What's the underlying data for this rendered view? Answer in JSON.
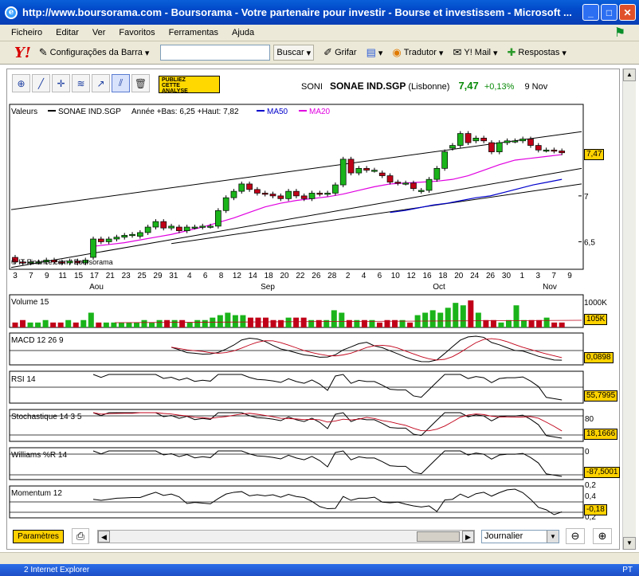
{
  "window": {
    "title": "http://www.boursorama.com - Boursorama - Votre partenaire pour investir - Bourse et investissem - Microsoft ...",
    "minimize": "_",
    "maximize": "□",
    "close": "✕"
  },
  "menu": [
    "Ficheiro",
    "Editar",
    "Ver",
    "Favoritos",
    "Ferramentas",
    "Ajuda"
  ],
  "toolbar": {
    "brand": "Y!",
    "config": "Configurações da Barra",
    "search_value": "",
    "search_button": "Buscar",
    "grifar": "Grifar",
    "tradutor": "Tradutor",
    "ymail": "Y! Mail",
    "respostas": "Respostas"
  },
  "publiez": {
    "line1": "PUBLIEZ",
    "line2": "CETTE",
    "line3": "ANALYSE"
  },
  "quote": {
    "symbol": "SONI",
    "name": "SONAE IND.SGP",
    "market": "(Lisbonne)",
    "price": "7,47",
    "change": "+0,13%",
    "date": "9 Nov"
  },
  "legend": {
    "valeurs": "Valeurs",
    "instrument": "SONAE IND.SGP",
    "range": "Année +Bas: 6,25 +Haut: 7,82",
    "ma50": "MA50",
    "ma20": "MA20",
    "ma50_color": "#0000cc",
    "ma20_color": "#e000e0"
  },
  "chart_data": {
    "type": "candlestick",
    "price_ticks": [
      "7",
      "6,5"
    ],
    "last_value_label": "7,47",
    "x_ticks": [
      "3",
      "7",
      "9",
      "11",
      "15",
      "17",
      "21",
      "23",
      "25",
      "29",
      "31",
      "4",
      "6",
      "8",
      "12",
      "14",
      "18",
      "20",
      "22",
      "26",
      "28",
      "2",
      "4",
      "6",
      "10",
      "12",
      "16",
      "18",
      "20",
      "24",
      "26",
      "30",
      "1",
      "3",
      "7",
      "9"
    ],
    "months": [
      "Aou",
      "Sep",
      "Oct",
      "Nov"
    ],
    "candles": [
      {
        "o": 6.33,
        "c": 6.28
      },
      {
        "o": 6.28,
        "c": 6.27
      },
      {
        "o": 6.27,
        "c": 6.28
      },
      {
        "o": 6.28,
        "c": 6.28
      },
      {
        "o": 6.28,
        "c": 6.3
      },
      {
        "o": 6.3,
        "c": 6.28
      },
      {
        "o": 6.28,
        "c": 6.27
      },
      {
        "o": 6.27,
        "c": 6.29
      },
      {
        "o": 6.29,
        "c": 6.27
      },
      {
        "o": 6.27,
        "c": 6.3
      },
      {
        "o": 6.33,
        "c": 6.53
      },
      {
        "o": 6.53,
        "c": 6.5
      },
      {
        "o": 6.5,
        "c": 6.53
      },
      {
        "o": 6.53,
        "c": 6.55
      },
      {
        "o": 6.55,
        "c": 6.57
      },
      {
        "o": 6.57,
        "c": 6.58
      },
      {
        "o": 6.56,
        "c": 6.6
      },
      {
        "o": 6.6,
        "c": 6.66
      },
      {
        "o": 6.66,
        "c": 6.72
      },
      {
        "o": 6.72,
        "c": 6.65
      },
      {
        "o": 6.65,
        "c": 6.67
      },
      {
        "o": 6.66,
        "c": 6.62
      },
      {
        "o": 6.62,
        "c": 6.66
      },
      {
        "o": 6.66,
        "c": 6.66
      },
      {
        "o": 6.66,
        "c": 6.67
      },
      {
        "o": 6.67,
        "c": 6.67
      },
      {
        "o": 6.67,
        "c": 6.84
      },
      {
        "o": 6.84,
        "c": 6.98
      },
      {
        "o": 6.98,
        "c": 7.05
      },
      {
        "o": 7.05,
        "c": 7.13
      },
      {
        "o": 7.13,
        "c": 7.07
      },
      {
        "o": 7.07,
        "c": 7.03
      },
      {
        "o": 7.03,
        "c": 7.02
      },
      {
        "o": 7.02,
        "c": 7.0
      },
      {
        "o": 7.0,
        "c": 6.97
      },
      {
        "o": 6.97,
        "c": 7.05
      },
      {
        "o": 7.05,
        "c": 7.0
      },
      {
        "o": 7.0,
        "c": 6.97
      },
      {
        "o": 6.97,
        "c": 7.03
      },
      {
        "o": 7.03,
        "c": 7.02
      },
      {
        "o": 7.02,
        "c": 7.03
      },
      {
        "o": 7.03,
        "c": 7.12
      },
      {
        "o": 7.12,
        "c": 7.4
      },
      {
        "o": 7.4,
        "c": 7.25
      },
      {
        "o": 7.25,
        "c": 7.3
      },
      {
        "o": 7.3,
        "c": 7.28
      },
      {
        "o": 7.28,
        "c": 7.28
      },
      {
        "o": 7.25,
        "c": 7.22
      },
      {
        "o": 7.22,
        "c": 7.15
      },
      {
        "o": 7.15,
        "c": 7.14
      },
      {
        "o": 7.14,
        "c": 7.14
      },
      {
        "o": 7.14,
        "c": 7.08
      },
      {
        "o": 7.05,
        "c": 7.06
      },
      {
        "o": 7.06,
        "c": 7.18
      },
      {
        "o": 7.18,
        "c": 7.3
      },
      {
        "o": 7.3,
        "c": 7.48
      },
      {
        "o": 7.52,
        "c": 7.55
      },
      {
        "o": 7.55,
        "c": 7.68
      },
      {
        "o": 7.68,
        "c": 7.58
      },
      {
        "o": 7.6,
        "c": 7.63
      },
      {
        "o": 7.63,
        "c": 7.6
      },
      {
        "o": 7.58,
        "c": 7.48
      },
      {
        "o": 7.48,
        "c": 7.58
      },
      {
        "o": 7.58,
        "c": 7.6
      },
      {
        "o": 7.6,
        "c": 7.6
      },
      {
        "o": 7.6,
        "c": 7.62
      },
      {
        "o": 7.62,
        "c": 7.55
      },
      {
        "o": 7.55,
        "c": 7.5
      },
      {
        "o": 7.5,
        "c": 7.5
      },
      {
        "o": 7.5,
        "c": 7.49
      },
      {
        "o": 7.49,
        "c": 7.47
      }
    ],
    "ma20": [
      6.45,
      6.47,
      6.49,
      6.52,
      6.55,
      6.58,
      6.62,
      6.66,
      6.71,
      6.76,
      6.82,
      6.88,
      6.92,
      6.95,
      6.97,
      6.99,
      7.02,
      7.06,
      7.1,
      7.13,
      7.14,
      7.15,
      7.16,
      7.18,
      7.22,
      7.28,
      7.34,
      7.39,
      7.41,
      7.43,
      7.45
    ],
    "ma50": [
      6.82,
      6.84,
      6.87,
      6.9,
      6.92,
      6.95,
      6.98,
      7.0,
      7.04,
      7.08,
      7.12,
      7.15,
      7.18
    ],
    "channel_upper": [
      6.85,
      7.7
    ],
    "channel_lower": [
      6.22,
      7.3
    ],
    "channel_inner": [
      6.48,
      7.13
    ]
  },
  "volume": {
    "label": "Volume 15",
    "ticks": [
      "1000K"
    ],
    "value_label": "105K",
    "bars": [
      2,
      3,
      2,
      2,
      3,
      2,
      2,
      3,
      2,
      3,
      6,
      2,
      2,
      2,
      2,
      2,
      2,
      3,
      2,
      3,
      3,
      3,
      3,
      2,
      3,
      3,
      4,
      5,
      6,
      5,
      5,
      4,
      4,
      4,
      3,
      3,
      4,
      4,
      4,
      3,
      3,
      3,
      7,
      6,
      3,
      3,
      3,
      3,
      2,
      3,
      3,
      3,
      2,
      5,
      6,
      7,
      6,
      8,
      10,
      9,
      11,
      6,
      3,
      3,
      2,
      3,
      9,
      3,
      3,
      3,
      4,
      2,
      2
    ]
  },
  "macd": {
    "label": "MACD 12 26 9",
    "value_label": "0,0898"
  },
  "rsi": {
    "label": "RSI 14",
    "value_label": "55,7995"
  },
  "stoch": {
    "label": "Stochastique 14 3 5",
    "tick": "80",
    "value_label": "18,1666"
  },
  "williams": {
    "label": "Williams %R 14",
    "tick": "0",
    "value_label": "-87,5001"
  },
  "momentum": {
    "label": "Momentum 12",
    "tick_hi": "0,4",
    "tick_mid": "0,2",
    "tick_lo": "0,2",
    "value_label": "-0,18"
  },
  "bottom": {
    "params": "Paramètres",
    "period": "Journalier"
  },
  "copyright": "© IT-Finance.com / Boursorama",
  "taskbar": {
    "item": "2 Internet Explorer",
    "lang": "PT"
  }
}
